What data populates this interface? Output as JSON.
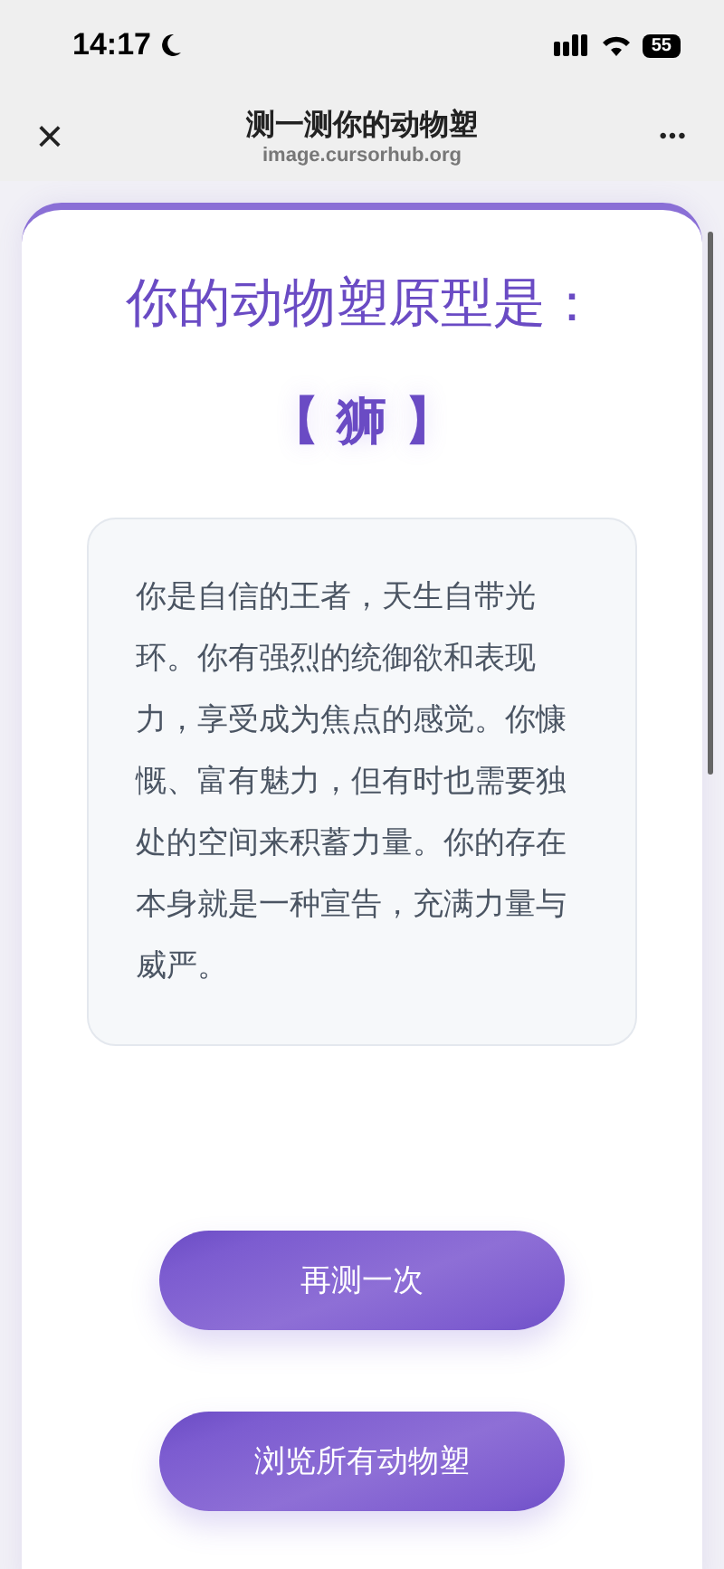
{
  "status_bar": {
    "time": "14:17",
    "battery": "55"
  },
  "nav_bar": {
    "close": "×",
    "title": "测一测你的动物塑",
    "subtitle": "image.cursorhub.org",
    "more": "•••"
  },
  "result": {
    "heading": "你的动物塑原型是：",
    "animal": "【 狮 】",
    "description": "你是自信的王者，天生自带光环。你有强烈的统御欲和表现力，享受成为焦点的感觉。你慷慨、富有魅力，但有时也需要独处的空间来积蓄力量。你的存在本身就是一种宣告，充满力量与威严。"
  },
  "buttons": [
    {
      "label": "再测一次"
    },
    {
      "label": "浏览所有动物塑"
    }
  ]
}
